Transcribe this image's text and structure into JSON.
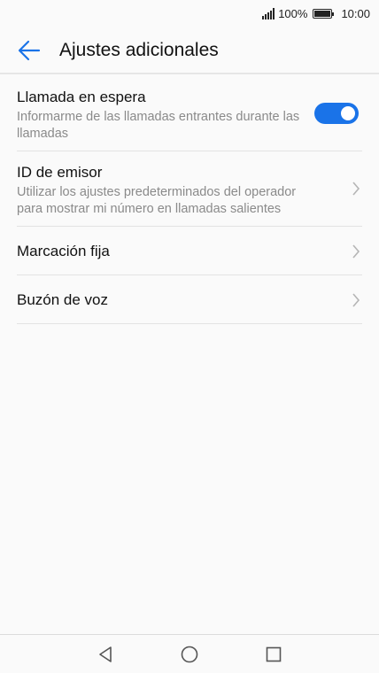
{
  "status_bar": {
    "battery_text": "100%",
    "time": "10:00"
  },
  "app_bar": {
    "back_icon": "arrow-left-icon",
    "title": "Ajustes adicionales",
    "accent_color": "#1a73e8"
  },
  "settings": [
    {
      "title": "Llamada en espera",
      "subtitle": "Informarme de las llamadas entrantes durante las llamadas",
      "control": "toggle",
      "toggle_on": true
    },
    {
      "title": "ID de emisor",
      "subtitle": "Utilizar los ajustes predeterminados del operador para mostrar mi número en llamadas salientes",
      "control": "chevron-right-icon"
    },
    {
      "title": "Marcación fija",
      "control": "chevron-right-icon"
    },
    {
      "title": "Buzón de voz",
      "control": "chevron-right-icon"
    }
  ],
  "nav_bar": {
    "icons": [
      "triangle-back-icon",
      "circle-home-icon",
      "square-recents-icon"
    ]
  }
}
